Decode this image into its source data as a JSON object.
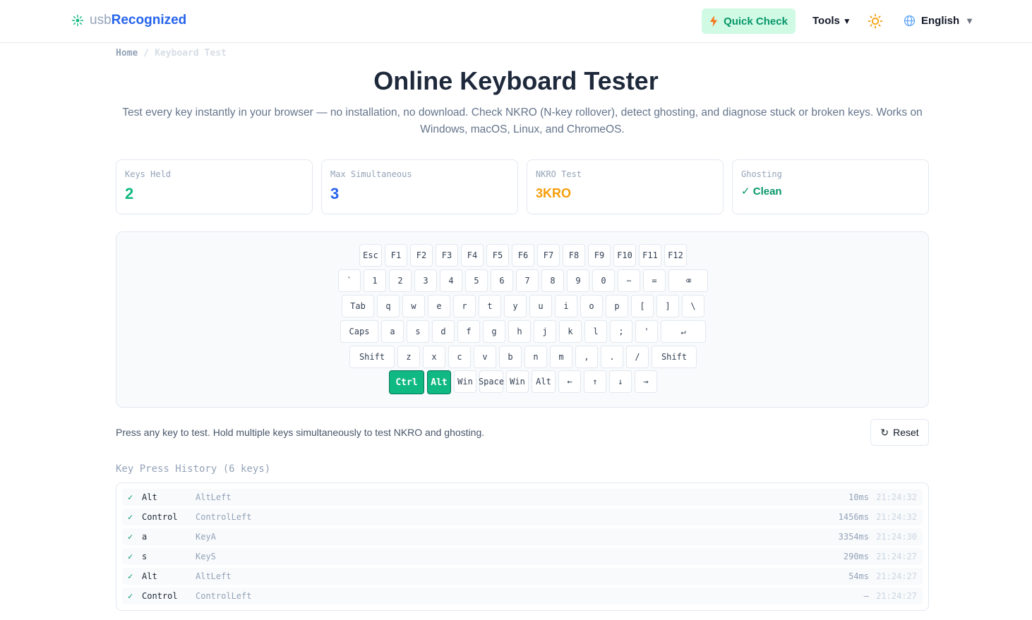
{
  "header": {
    "logo_light": "usb",
    "logo_bold": "Recognized",
    "quick_check": "Quick Check",
    "tools": "Tools",
    "tools_caret": "▼",
    "language": "English",
    "language_caret": "▼"
  },
  "breadcrumb": {
    "home": "Home",
    "sep": "/",
    "current": "Keyboard Test"
  },
  "page": {
    "title": "Online Keyboard Tester",
    "subtitle": "Test every key instantly in your browser — no installation, no download. Check NKRO (N-key rollover), detect ghosting, and diagnose stuck or broken keys. Works on Windows, macOS, Linux, and ChromeOS."
  },
  "stats": [
    {
      "label": "Keys Held",
      "value": "2",
      "color": "#10b981"
    },
    {
      "label": "Max Simultaneous",
      "value": "3",
      "color": "#2563eb"
    },
    {
      "label": "NKRO Test",
      "value": "3KRO",
      "color": "#f59e0b"
    },
    {
      "label": "Ghosting",
      "value": "✓ Clean",
      "color": "#059669"
    }
  ],
  "keyboard": {
    "rows": [
      [
        {
          "l": "Esc"
        },
        {
          "l": "F1"
        },
        {
          "l": "F2"
        },
        {
          "l": "F3"
        },
        {
          "l": "F4"
        },
        {
          "l": "F5"
        },
        {
          "l": "F6"
        },
        {
          "l": "F7"
        },
        {
          "l": "F8"
        },
        {
          "l": "F9"
        },
        {
          "l": "F10"
        },
        {
          "l": "F11"
        },
        {
          "l": "F12"
        }
      ],
      [
        {
          "l": "`"
        },
        {
          "l": "1"
        },
        {
          "l": "2"
        },
        {
          "l": "3"
        },
        {
          "l": "4"
        },
        {
          "l": "5"
        },
        {
          "l": "6"
        },
        {
          "l": "7"
        },
        {
          "l": "8"
        },
        {
          "l": "9"
        },
        {
          "l": "0"
        },
        {
          "l": "−"
        },
        {
          "l": "="
        },
        {
          "l": "⌫"
        }
      ],
      [
        {
          "l": "Tab"
        },
        {
          "l": "q"
        },
        {
          "l": "w"
        },
        {
          "l": "e"
        },
        {
          "l": "r"
        },
        {
          "l": "t"
        },
        {
          "l": "y"
        },
        {
          "l": "u"
        },
        {
          "l": "i"
        },
        {
          "l": "o"
        },
        {
          "l": "p"
        },
        {
          "l": "["
        },
        {
          "l": "]"
        },
        {
          "l": "\\"
        }
      ],
      [
        {
          "l": "Caps"
        },
        {
          "l": "a"
        },
        {
          "l": "s"
        },
        {
          "l": "d"
        },
        {
          "l": "f"
        },
        {
          "l": "g"
        },
        {
          "l": "h"
        },
        {
          "l": "j"
        },
        {
          "l": "k"
        },
        {
          "l": "l"
        },
        {
          "l": ";"
        },
        {
          "l": "'"
        },
        {
          "l": "↵"
        }
      ],
      [
        {
          "l": "Shift"
        },
        {
          "l": "z"
        },
        {
          "l": "x"
        },
        {
          "l": "c"
        },
        {
          "l": "v"
        },
        {
          "l": "b"
        },
        {
          "l": "n"
        },
        {
          "l": "m"
        },
        {
          "l": ","
        },
        {
          "l": "."
        },
        {
          "l": "/"
        },
        {
          "l": "Shift"
        }
      ],
      [
        {
          "l": "Ctrl",
          "active": true
        },
        {
          "l": "Alt",
          "active": true
        },
        {
          "l": "Win"
        },
        {
          "l": "Space"
        },
        {
          "l": "Win"
        },
        {
          "l": "Alt"
        },
        {
          "l": "←"
        },
        {
          "l": "↑"
        },
        {
          "l": "↓"
        },
        {
          "l": "→"
        }
      ]
    ]
  },
  "hint": "Press any key to test. Hold multiple keys simultaneously to test NKRO and ghosting.",
  "reset_label": "Reset",
  "history": {
    "title": "Key Press History (6 keys)",
    "items": [
      {
        "check": "✓",
        "key": "Alt",
        "code": "AltLeft",
        "duration": "10ms",
        "time": "21:24:32"
      },
      {
        "check": "✓",
        "key": "Control",
        "code": "ControlLeft",
        "duration": "1456ms",
        "time": "21:24:32"
      },
      {
        "check": "✓",
        "key": "a",
        "code": "KeyA",
        "duration": "3354ms",
        "time": "21:24:30"
      },
      {
        "check": "✓",
        "key": "s",
        "code": "KeyS",
        "duration": "290ms",
        "time": "21:24:27"
      },
      {
        "check": "✓",
        "key": "Alt",
        "code": "AltLeft",
        "duration": "54ms",
        "time": "21:24:27"
      },
      {
        "check": "✓",
        "key": "Control",
        "code": "ControlLeft",
        "duration": "—",
        "time": "21:24:27"
      }
    ]
  }
}
